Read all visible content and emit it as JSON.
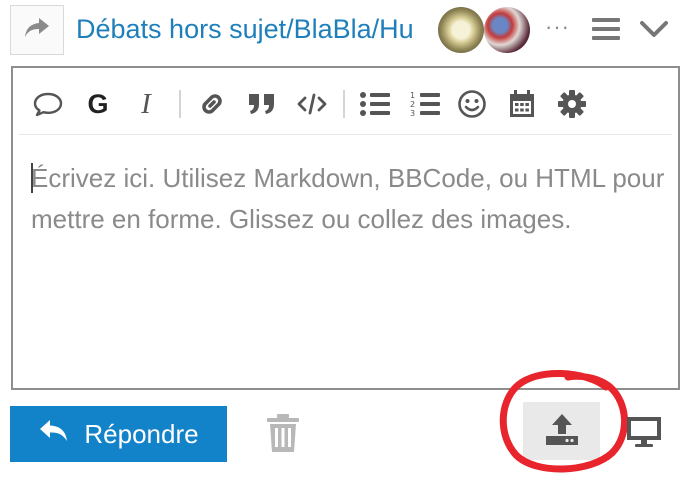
{
  "header": {
    "reply_type_icon": "share-arrow-icon",
    "topic_title": "Débats hors sujet/BlaBla/Hu",
    "participants": [
      {
        "icon": "avatar-white-rose"
      },
      {
        "icon": "avatar-group-photo"
      }
    ],
    "more_users": "···",
    "menu_icon": "hamburger-icon",
    "collapse_icon": "chevron-down-icon"
  },
  "toolbar": {
    "buttons": [
      {
        "icon": "speech-bubble-icon"
      },
      {
        "label": "G"
      },
      {
        "label": "I"
      },
      {
        "icon": "link-icon"
      },
      {
        "icon": "quote-icon"
      },
      {
        "icon": "code-icon"
      },
      {
        "icon": "bullet-list-icon"
      },
      {
        "icon": "numbered-list-icon"
      },
      {
        "icon": "smiley-icon"
      },
      {
        "icon": "calendar-icon"
      },
      {
        "icon": "gear-icon"
      }
    ]
  },
  "editor": {
    "placeholder": "Écrivez ici. Utilisez Markdown, BBCode, ou HTML pour mettre en forme. Glissez ou collez des images."
  },
  "footer": {
    "reply_label": "Répondre",
    "reply_icon": "reply-arrow-icon",
    "trash_icon": "trash-icon",
    "upload_icon": "upload-icon",
    "preview_icon": "monitor-icon"
  },
  "colors": {
    "accent": "#1283c9",
    "title": "#1e7fba",
    "annotation": "#e8252c"
  }
}
